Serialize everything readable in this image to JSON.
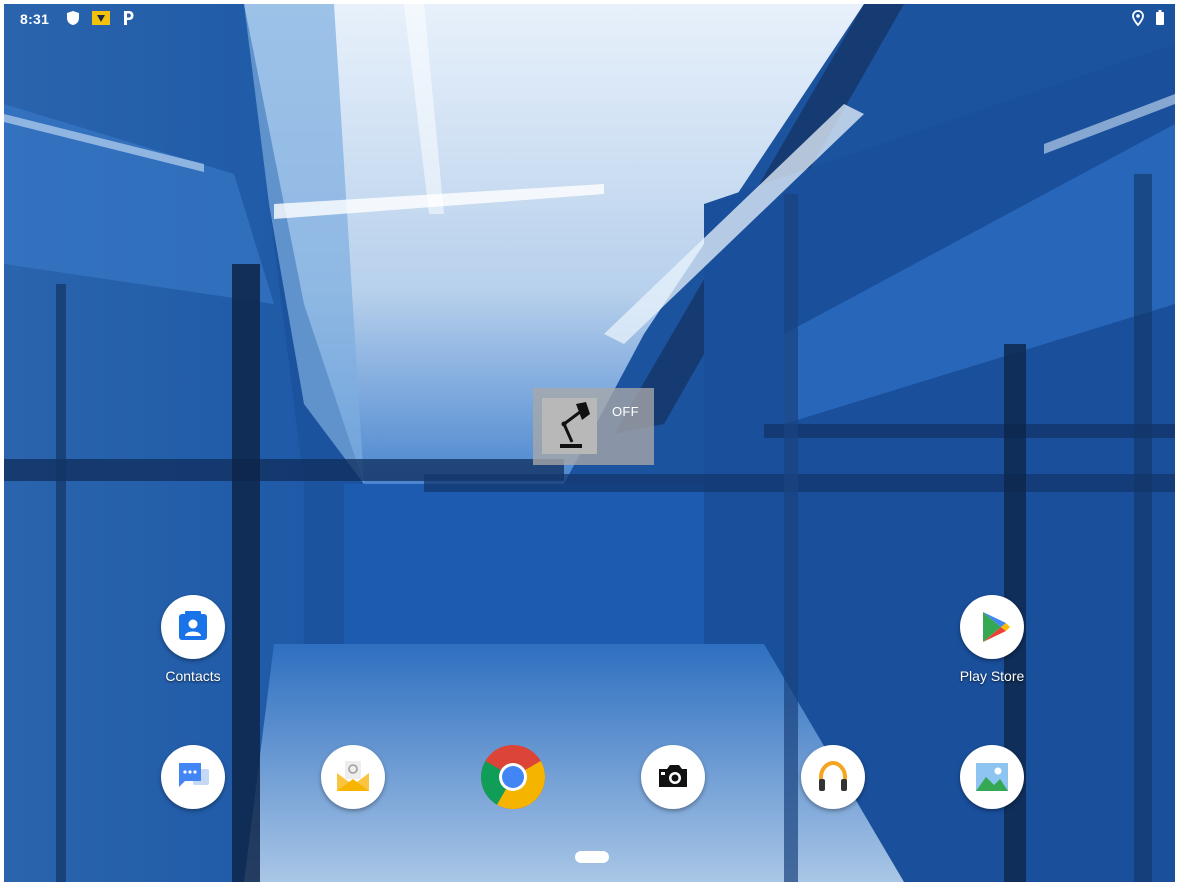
{
  "status_bar": {
    "time": "8:31",
    "left_icons": [
      "shield-icon",
      "sim-notification-icon",
      "p-notification-icon"
    ],
    "right_icons": [
      "location-icon",
      "battery-icon"
    ]
  },
  "widget": {
    "state_text": "OFF",
    "icon": "desk-lamp-icon"
  },
  "apps": {
    "contacts": {
      "label": "Contacts",
      "icon": "contacts-icon",
      "color": "#1a73e8"
    },
    "play_store": {
      "label": "Play Store",
      "icon": "play-store-icon"
    }
  },
  "dock": [
    {
      "name": "messages",
      "icon": "messages-icon",
      "color": "#4285f4"
    },
    {
      "name": "email",
      "icon": "email-icon",
      "color": "#f9c440"
    },
    {
      "name": "chrome",
      "icon": "chrome-icon"
    },
    {
      "name": "camera",
      "icon": "camera-icon",
      "color": "#000000"
    },
    {
      "name": "music",
      "icon": "headphones-icon",
      "color": "#f4a522"
    },
    {
      "name": "gallery",
      "icon": "gallery-icon",
      "color": "#34a853"
    }
  ],
  "colors": {
    "wallpaper_base": "#1b4f9a",
    "accent_light": "#dbe8f7"
  }
}
